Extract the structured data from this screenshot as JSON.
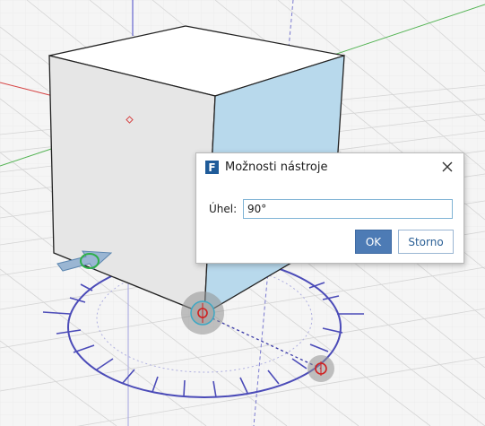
{
  "dialog": {
    "app_icon_letter": "F",
    "title": "Možnosti nástroje",
    "angle_label": "Úhel:",
    "angle_value": "90°",
    "ok_label": "OK",
    "cancel_label": "Storno"
  },
  "colors": {
    "cube_face_top": "#ffffff",
    "cube_face_front": "#e6e6e6",
    "cube_face_selected": "#b8d9ec",
    "protractor": "#4b4bb8",
    "axis_x": "#d64545",
    "axis_y": "#54b454",
    "axis_z": "#4848c8",
    "ok_button": "#4d7bb5"
  }
}
